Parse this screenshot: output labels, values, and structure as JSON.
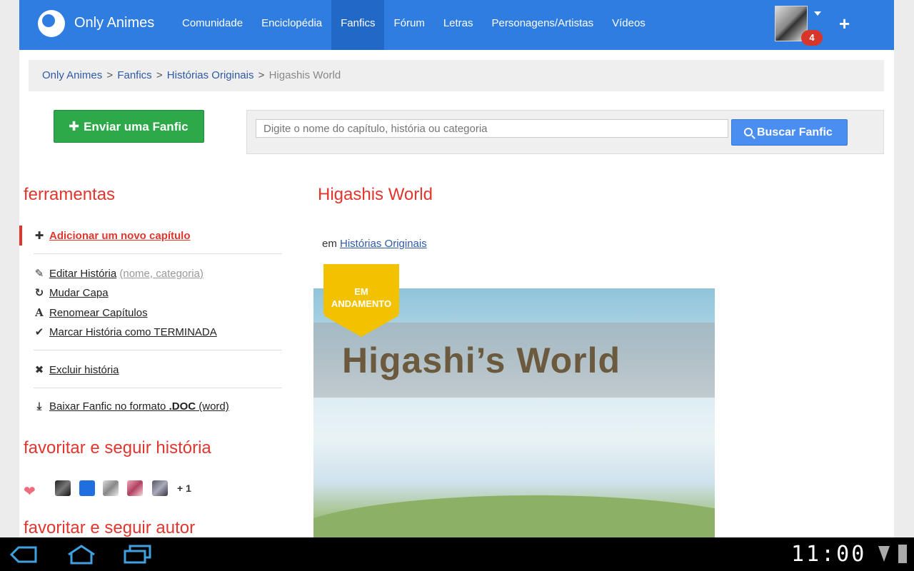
{
  "header": {
    "brand": "Only Animes",
    "nav": [
      "Comunidade",
      "Enciclopédia",
      "Fanfics",
      "Fórum",
      "Letras",
      "Personagens/Artistas",
      "Vídeos"
    ],
    "active_nav": "Fanfics",
    "notifications": "4",
    "add_icon": "plus-icon",
    "color": "#2f7de1"
  },
  "breadcrumb": {
    "items": [
      "Only Animes",
      "Fanfics",
      "Histórias Originais"
    ],
    "current": "Higashis World",
    "separator": ">"
  },
  "actions": {
    "send_fanfic": "Enviar uma Fanfic",
    "search_placeholder": "Digite o nome do capítulo, história ou categoria",
    "search_button": "Buscar Fanfic"
  },
  "tools": {
    "title": "ferramentas",
    "add_chapter": "Adicionar um novo capítulo",
    "edit_story": "Editar História",
    "edit_story_hint": "(nome, categoria)",
    "change_cover": "Mudar Capa",
    "rename_chapters": "Renomear Capítulos",
    "mark_finished": "Marcar História como TERMINADA",
    "delete_story": "Excluir história",
    "download_prefix": "Baixar Fanfic no formato ",
    "download_format": ".DOC",
    "download_suffix": " (word)"
  },
  "favorites": {
    "title_story": "favoritar e seguir história",
    "more": "+ 1",
    "title_author": "favoritar e seguir autor"
  },
  "story": {
    "title": "Higashis World",
    "category_prefix": "em",
    "category": "Histórias Originais",
    "status_ribbon_line1": "EM",
    "status_ribbon_line2": "ANDAMENTO",
    "cover_text": "Higashi’s World"
  },
  "system_bar": {
    "time": "11:00"
  }
}
